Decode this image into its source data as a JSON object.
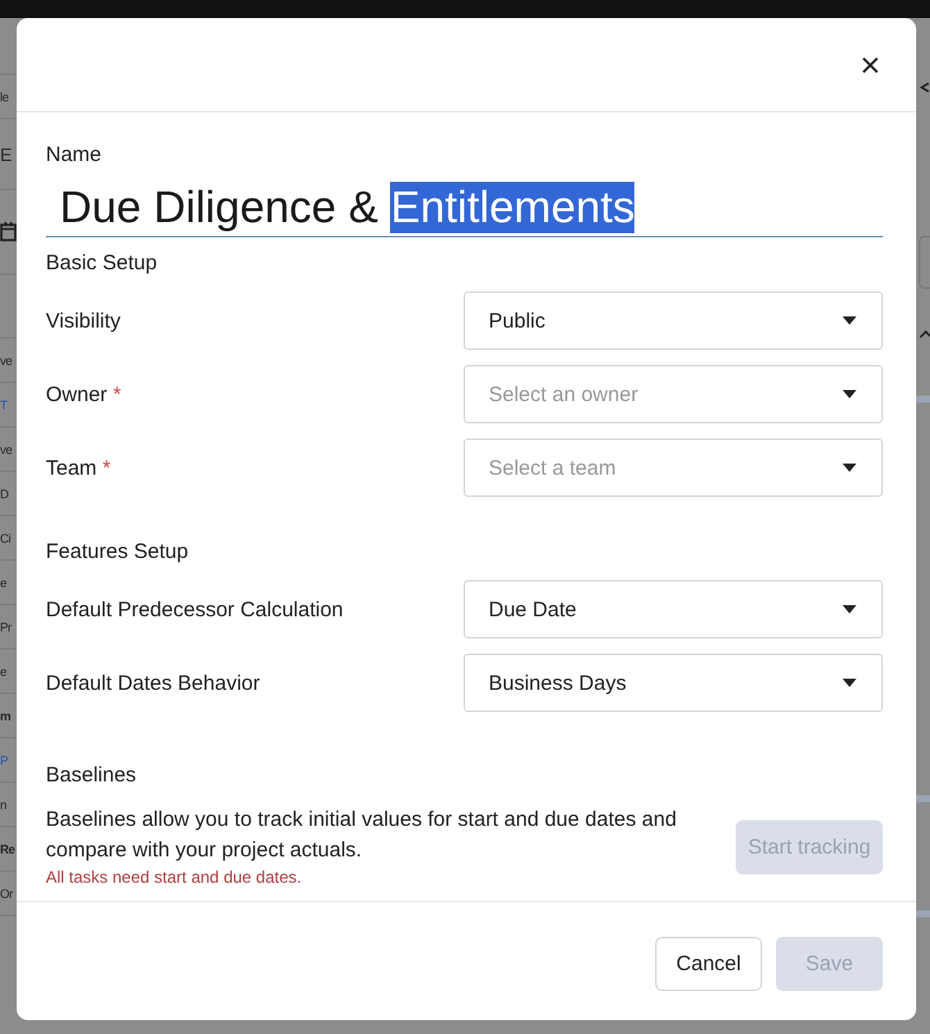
{
  "background": {
    "fragments": [
      {
        "text": "le",
        "kind": "plain"
      },
      {
        "text": "E",
        "kind": "heading"
      },
      {
        "text": "ve",
        "kind": "plain"
      },
      {
        "text": "T",
        "kind": "link"
      },
      {
        "text": "ve",
        "kind": "plain"
      },
      {
        "text": "D",
        "kind": "plain"
      },
      {
        "text": "Ci",
        "kind": "plain"
      },
      {
        "text": "e",
        "kind": "plain"
      },
      {
        "text": "Pr",
        "kind": "plain"
      },
      {
        "text": "e",
        "kind": "plain"
      },
      {
        "text": "m",
        "kind": "bold"
      },
      {
        "text": "P",
        "kind": "link"
      },
      {
        "text": "n",
        "kind": "plain"
      },
      {
        "text": "Re",
        "kind": "bold"
      },
      {
        "text": "Or",
        "kind": "plain"
      }
    ]
  },
  "dialog": {
    "name": {
      "label": "Name",
      "value_parts": [
        {
          "text": "Due Diligence & ",
          "selected": false
        },
        {
          "text": "Entitlements",
          "selected": true
        }
      ]
    },
    "sections": [
      {
        "title": "Basic Setup",
        "fields": [
          {
            "label": "Visibility",
            "value": "Public"
          },
          {
            "label": "Owner",
            "required_marker": "*",
            "placeholder": "Select an owner"
          },
          {
            "label": "Team",
            "required_marker": "*",
            "placeholder": "Select a team"
          }
        ]
      },
      {
        "title": "Features Setup",
        "fields": [
          {
            "label": "Default Predecessor Calculation",
            "value": "Due Date"
          },
          {
            "label": "Default Dates Behavior",
            "value": "Business Days"
          }
        ]
      }
    ],
    "baselines": {
      "title": "Baselines",
      "description": "Baselines allow you to track initial values for start and due dates and compare with your project actuals.",
      "error": "All tasks need start and due dates.",
      "button": {
        "label": "Start tracking",
        "disabled": true
      }
    },
    "buttons": [
      {
        "label": "Cancel",
        "kind": "secondary",
        "disabled": false
      },
      {
        "label": "Save",
        "kind": "primary",
        "disabled": true
      }
    ]
  }
}
